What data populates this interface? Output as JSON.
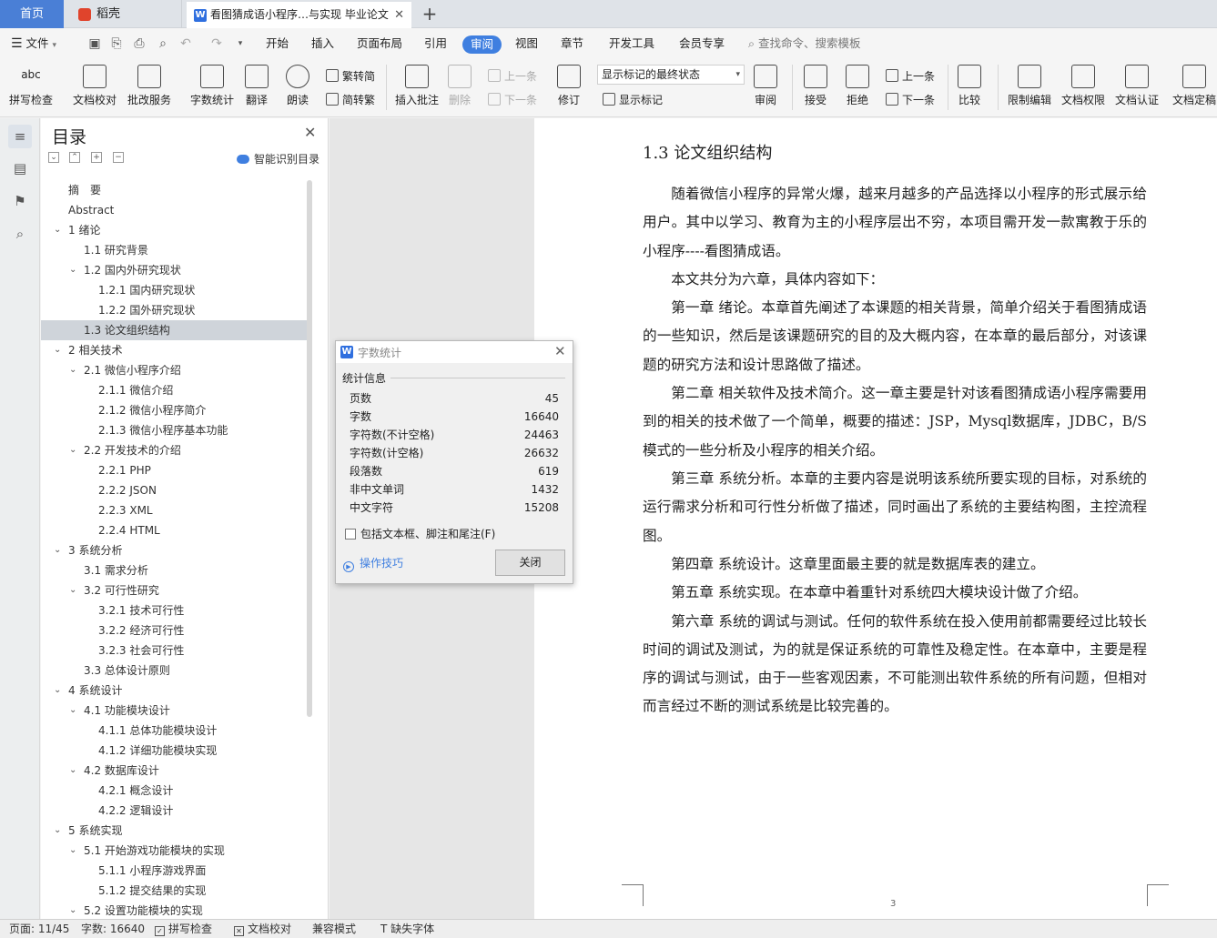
{
  "tabs": {
    "home": "首页",
    "daoke": "稻壳",
    "document": "看图猜成语小程序…与实现 毕业论文",
    "add": "+"
  },
  "menu": {
    "file": "文件",
    "items": [
      "开始",
      "插入",
      "页面布局",
      "引用",
      "审阅",
      "视图",
      "章节",
      "开发工具",
      "会员专享"
    ],
    "active": "审阅",
    "search_placeholder": "查找命令、搜索模板"
  },
  "ribbon": {
    "spell_check": "拼写检查",
    "doc_proof": "文档校对",
    "batch_service": "批改服务",
    "word_count": "字数统计",
    "translate": "翻译",
    "read_aloud": "朗读",
    "to_traditional": "繁转简",
    "to_simplified": "简转繁",
    "insert_comment": "插入批注",
    "delete": "删除",
    "prev_item": "上一条",
    "next_item": "下一条",
    "revise": "修订",
    "display_state": "显示标记的最终状态",
    "show_markup": "显示标记",
    "review": "审阅",
    "accept": "接受",
    "reject": "拒绝",
    "prev": "上一条",
    "next": "下一条",
    "compare": "比较",
    "restrict_edit": "限制编辑",
    "doc_permission": "文档权限",
    "doc_auth": "文档认证",
    "doc_finalize": "文档定稿"
  },
  "toc": {
    "title": "目录",
    "smart_label": "智能识别目录",
    "items": [
      {
        "label": "摘　要",
        "level": 0,
        "caret": false
      },
      {
        "label": "Abstract",
        "level": 0,
        "caret": false
      },
      {
        "label": "1  绪论",
        "level": 0,
        "caret": true
      },
      {
        "label": "1.1  研究背景",
        "level": 1,
        "caret": false
      },
      {
        "label": "1.2  国内外研究现状",
        "level": 1,
        "caret": true
      },
      {
        "label": "1.2.1  国内研究现状",
        "level": 2,
        "caret": false
      },
      {
        "label": "1.2.2  国外研究现状",
        "level": 2,
        "caret": false
      },
      {
        "label": "1.3  论文组织结构",
        "level": 1,
        "caret": false,
        "selected": true
      },
      {
        "label": "2  相关技术",
        "level": 0,
        "caret": true
      },
      {
        "label": "2.1 微信小程序介绍",
        "level": 1,
        "caret": true
      },
      {
        "label": "2.1.1 微信介绍",
        "level": 2,
        "caret": false
      },
      {
        "label": "2.1.2 微信小程序简介",
        "level": 2,
        "caret": false
      },
      {
        "label": "2.1.3 微信小程序基本功能",
        "level": 2,
        "caret": false
      },
      {
        "label": "2.2 开发技术的介绍",
        "level": 1,
        "caret": true
      },
      {
        "label": "2.2.1 PHP",
        "level": 2,
        "caret": false
      },
      {
        "label": "2.2.2 JSON",
        "level": 2,
        "caret": false
      },
      {
        "label": "2.2.3 XML",
        "level": 2,
        "caret": false
      },
      {
        "label": "2.2.4 HTML",
        "level": 2,
        "caret": false
      },
      {
        "label": "3  系统分析",
        "level": 0,
        "caret": true
      },
      {
        "label": "3.1  需求分析",
        "level": 1,
        "caret": false
      },
      {
        "label": "3.2  可行性研究",
        "level": 1,
        "caret": true
      },
      {
        "label": "3.2.1  技术可行性",
        "level": 2,
        "caret": false
      },
      {
        "label": "3.2.2  经济可行性",
        "level": 2,
        "caret": false
      },
      {
        "label": "3.2.3  社会可行性",
        "level": 2,
        "caret": false
      },
      {
        "label": "3.3  总体设计原则",
        "level": 1,
        "caret": false
      },
      {
        "label": "4  系统设计",
        "level": 0,
        "caret": true
      },
      {
        "label": "4.1  功能模块设计",
        "level": 1,
        "caret": true
      },
      {
        "label": "4.1.1  总体功能模块设计",
        "level": 2,
        "caret": false
      },
      {
        "label": "4.1.2  详细功能模块实现",
        "level": 2,
        "caret": false
      },
      {
        "label": "4.2  数据库设计",
        "level": 1,
        "caret": true
      },
      {
        "label": "4.2.1  概念设计",
        "level": 2,
        "caret": false
      },
      {
        "label": "4.2.2  逻辑设计",
        "level": 2,
        "caret": false
      },
      {
        "label": "5  系统实现",
        "level": 0,
        "caret": true
      },
      {
        "label": "5.1  开始游戏功能模块的实现",
        "level": 1,
        "caret": true
      },
      {
        "label": "5.1.1 小程序游戏界面",
        "level": 2,
        "caret": false
      },
      {
        "label": "5.1.2  提交结果的实现",
        "level": 2,
        "caret": false
      },
      {
        "label": "5.2  设置功能模块的实现",
        "level": 1,
        "caret": true
      }
    ]
  },
  "document": {
    "heading": "1.3  论文组织结构",
    "paragraphs": [
      "随着微信小程序的异常火爆，越来月越多的产品选择以小程序的形式展示给用户。其中以学习、教育为主的小程序层出不穷，本项目需开发一款寓教于乐的小程序----看图猜成语。",
      "本文共分为六章，具体内容如下：",
      "第一章  绪论。本章首先阐述了本课题的相关背景，简单介绍关于看图猜成语的一些知识，然后是该课题研究的目的及大概内容，在本章的最后部分，对该课题的研究方法和设计思路做了描述。",
      "第二章  相关软件及技术简介。这一章主要是针对该看图猜成语小程序需要用到的相关的技术做了一个简单，概要的描述：JSP，Mysql数据库，JDBC，B/S模式的一些分析及小程序的相关介绍。",
      "第三章  系统分析。本章的主要内容是说明该系统所要实现的目标，对系统的运行需求分析和可行性分析做了描述，同时画出了系统的主要结构图，主控流程图。",
      "第四章  系统设计。这章里面最主要的就是数据库表的建立。",
      "第五章  系统实现。在本章中着重针对系统四大模块设计做了介绍。",
      "第六章  系统的调试与测试。任何的软件系统在投入使用前都需要经过比较长时间的调试及测试，为的就是保证系统的可靠性及稳定性。在本章中，主要是程序的调试与测试，由于一些客观因素，不可能测出软件系统的所有问题，但相对而言经过不断的测试系统是比较完善的。"
    ],
    "page_number": "3"
  },
  "dialog": {
    "title": "字数统计",
    "section": "统计信息",
    "stats": [
      {
        "label": "页数",
        "value": "45"
      },
      {
        "label": "字数",
        "value": "16640"
      },
      {
        "label": "字符数(不计空格)",
        "value": "24463"
      },
      {
        "label": "字符数(计空格)",
        "value": "26632"
      },
      {
        "label": "段落数",
        "value": "619"
      },
      {
        "label": "非中文单词",
        "value": "1432"
      },
      {
        "label": "中文字符",
        "value": "15208"
      }
    ],
    "include_label": "包括文本框、脚注和尾注(F)",
    "tips": "操作技巧",
    "close": "关闭"
  },
  "status": {
    "page": "页面: 11/45",
    "words": "字数: 16640",
    "spell": "拼写检查",
    "proof": "文档校对",
    "compat": "兼容模式",
    "missing_font": "缺失字体"
  }
}
